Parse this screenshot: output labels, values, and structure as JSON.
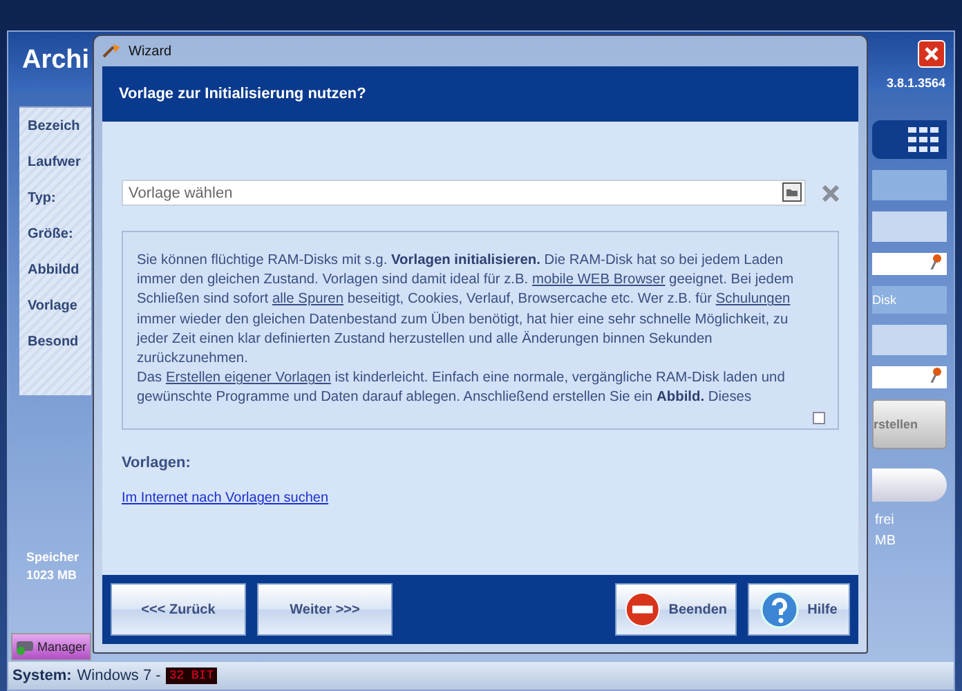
{
  "background_window": {
    "title": "Archi",
    "version": "3.8.1.3564",
    "fields": [
      "Bezeich",
      "Laufwer",
      "Typ:",
      "Größe:",
      "Abbildd",
      "Vorlage",
      "Besond"
    ],
    "memory_label": "Speicher",
    "memory_value": "1023 MB",
    "right_label": "Disk",
    "create_button": "rstellen",
    "free_label": "frei",
    "free_value": "MB",
    "taskbar_button": "Manager"
  },
  "status_bar": {
    "label": "System:",
    "os": "Windows 7 -",
    "bits": "32 BIT"
  },
  "dialog": {
    "title": "Wizard",
    "heading": "Vorlage zur Initialisierung nutzen?",
    "template_field": {
      "placeholder": "Vorlage wählen"
    },
    "description": [
      [
        {
          "kind": "plain",
          "text": "Sie können flüchtige RAM-Disks mit s.g. "
        },
        {
          "kind": "bold",
          "text": "Vorlagen initialisieren."
        },
        {
          "kind": "plain",
          "text": " Die RAM-Disk hat so bei jedem Laden immer den gleichen Zustand. Vorlagen sind damit ideal für z.B. "
        },
        {
          "kind": "link",
          "text": "mobile WEB Browser"
        },
        {
          "kind": "plain",
          "text": " geeignet. Bei jedem Schließen sind sofort "
        },
        {
          "kind": "link",
          "text": "alle Spuren"
        },
        {
          "kind": "plain",
          "text": " beseitigt, Cookies, Verlauf, Browsercache etc. Wer z.B. für "
        },
        {
          "kind": "link",
          "text": "Schulungen"
        },
        {
          "kind": "plain",
          "text": " immer wieder den gleichen Datenbestand zum Üben benötigt, hat hier eine sehr schnelle Möglichkeit, zu jeder Zeit einen klar definierten Zustand herzustellen und alle Änderungen binnen Sekunden zurückzunehmen."
        }
      ],
      [
        {
          "kind": "plain",
          "text": "Das "
        },
        {
          "kind": "link",
          "text": "Erstellen eigener Vorlagen"
        },
        {
          "kind": "plain",
          "text": " ist kinderleicht. Einfach eine normale, vergängliche RAM-Disk laden und gewünschte Programme und Daten darauf ablegen. Anschließend erstellen Sie ein "
        },
        {
          "kind": "bold",
          "text": "Abbild."
        },
        {
          "kind": "plain",
          "text": " Dieses"
        }
      ]
    ],
    "templates_label": "Vorlagen:",
    "search_link": "Im Internet nach Vorlagen suchen",
    "buttons": [
      {
        "label": "<<< Zurück",
        "kind": "nav"
      },
      {
        "label": "Weiter >>>",
        "kind": "nav"
      },
      {
        "label": "Beenden",
        "kind": "quit"
      },
      {
        "label": "Hilfe",
        "kind": "help"
      }
    ]
  }
}
